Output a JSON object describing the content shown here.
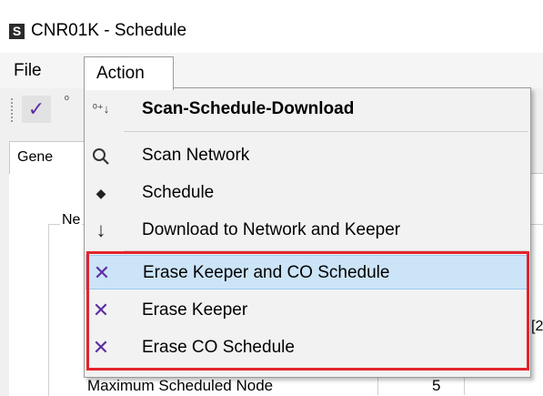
{
  "window": {
    "icon_glyph": "S",
    "title": "CNR01K - Schedule"
  },
  "menubar": {
    "file_label": "File",
    "action_label": "Action"
  },
  "toolbar": {
    "check_icon": "check-icon",
    "partial_text": "º"
  },
  "tabs": {
    "general_label": "Gene"
  },
  "group": {
    "label": "Ne"
  },
  "side_partial": "[2",
  "max_node": {
    "label": "Maximum Scheduled Node",
    "value": "5"
  },
  "action_menu": {
    "items": [
      {
        "label": "Scan-Schedule-Download",
        "icon": "scan-schedule-download-icon",
        "glyph": "⁰⁺↓",
        "bold": true
      },
      {
        "label": "Scan Network",
        "icon": "magnifier-icon",
        "glyph": "⚲"
      },
      {
        "label": "Schedule",
        "icon": "diamond-icon",
        "glyph": "◆"
      },
      {
        "label": "Download to Network and Keeper",
        "icon": "down-arrow-icon",
        "glyph": "↓"
      },
      {
        "label": "Erase Keeper and CO Schedule",
        "icon": "x-icon",
        "glyph": "✕",
        "highlighted": true
      },
      {
        "label": "Erase Keeper",
        "icon": "x-icon",
        "glyph": "✕"
      },
      {
        "label": "Erase CO Schedule",
        "icon": "x-icon",
        "glyph": "✕"
      }
    ]
  },
  "colors": {
    "highlight": "#cce4f7",
    "annotation_red": "#e3242b",
    "x_purple": "#5b2ea6"
  }
}
